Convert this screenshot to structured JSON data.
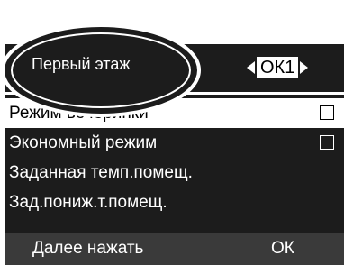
{
  "header": {
    "title": "Первый этаж",
    "program_label": "ОК1"
  },
  "menu": {
    "items": [
      {
        "label": "Режим вечеринки",
        "checkbox": true,
        "checked": false,
        "selected": true
      },
      {
        "label": "Экономный режим",
        "checkbox": true,
        "checked": false,
        "selected": false
      },
      {
        "label": "Заданная темп.помещ.",
        "checkbox": false,
        "selected": false
      },
      {
        "label": "Зад.пониж.т.помещ.",
        "checkbox": false,
        "selected": false
      }
    ]
  },
  "footer": {
    "hint": "Далее нажать",
    "ok_label": "ОК"
  },
  "colors": {
    "background": "#1c1c1c",
    "footer": "#3a3a3a",
    "text": "#ffffff",
    "selected_background": "#ffffff"
  }
}
